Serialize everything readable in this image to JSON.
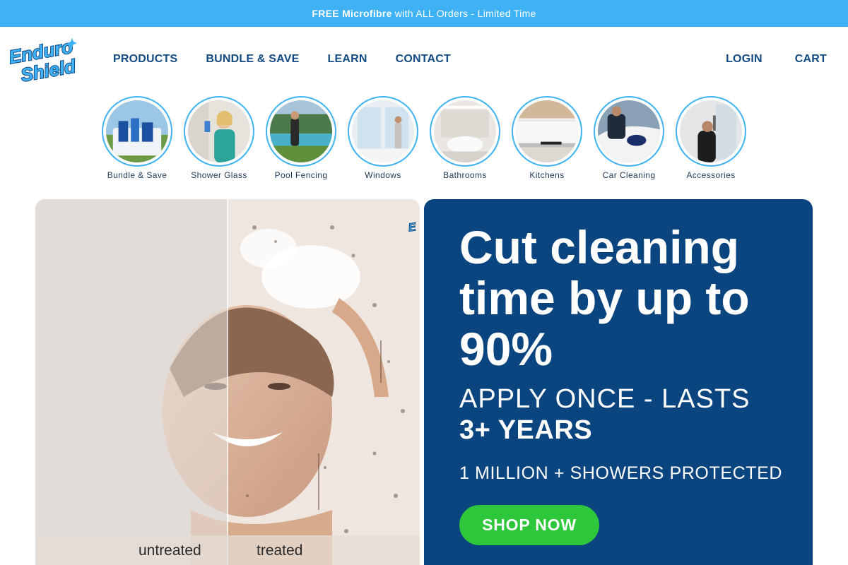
{
  "promo": {
    "strong": "FREE Microfibre",
    "text": "with ALL Orders - Limited Time"
  },
  "logo": {
    "line1": "Enduro",
    "line2": "Shield"
  },
  "nav": {
    "products": "PRODUCTS",
    "bundle": "BUNDLE & SAVE",
    "learn": "LEARN",
    "contact": "CONTACT",
    "login": "LOGIN",
    "cart": "CART"
  },
  "categories": [
    {
      "label": "Bundle & Save"
    },
    {
      "label": "Shower Glass"
    },
    {
      "label": "Pool Fencing"
    },
    {
      "label": "Windows"
    },
    {
      "label": "Bathrooms"
    },
    {
      "label": "Kitchens"
    },
    {
      "label": "Car Cleaning"
    },
    {
      "label": "Accessories"
    }
  ],
  "hero": {
    "untreated": "untreated",
    "treated": "treated",
    "headline": "Cut cleaning time by up to 90%",
    "sub1": "APPLY ONCE - LASTS",
    "sub2": "3+ YEARS",
    "sub3": "1 MILLION + SHOWERS PROTECTED",
    "cta": "SHOP NOW"
  },
  "colors": {
    "promo_bg": "#3eb2f5",
    "nav_text": "#134b84",
    "panel_bg": "#0b4580",
    "cta_bg": "#2ec73c"
  }
}
